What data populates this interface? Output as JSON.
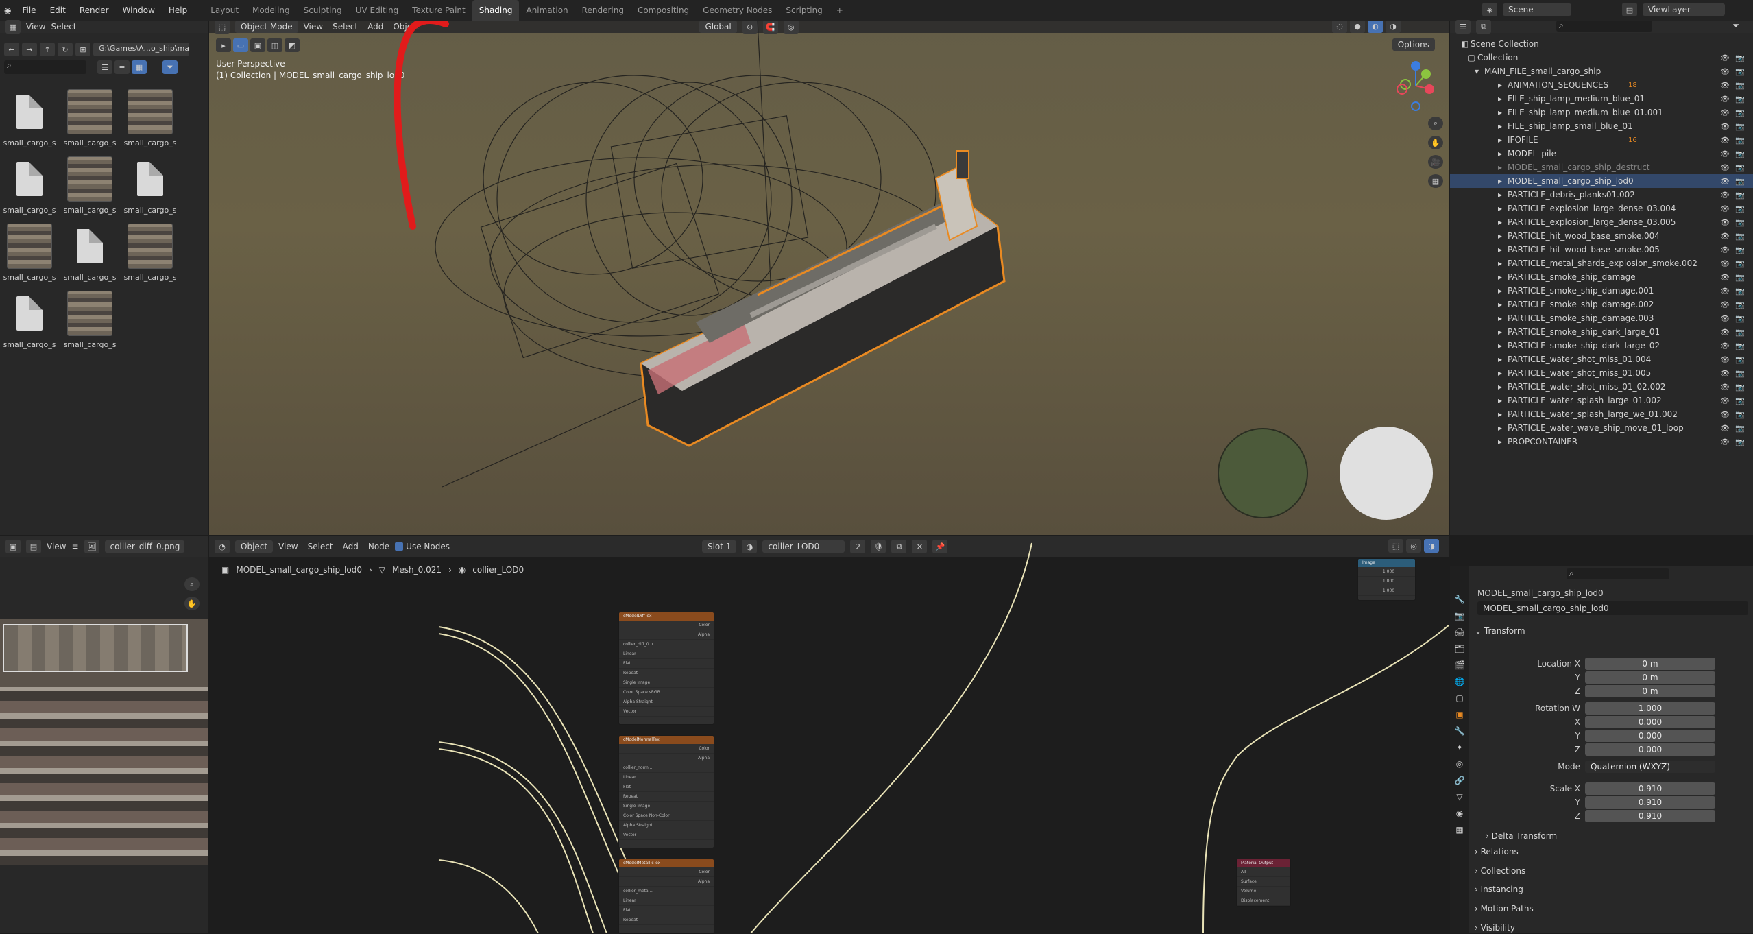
{
  "topbar": {
    "menus": [
      "File",
      "Edit",
      "Render",
      "Window",
      "Help"
    ],
    "workspaces": [
      "Layout",
      "Modeling",
      "Sculpting",
      "UV Editing",
      "Texture Paint",
      "Shading",
      "Animation",
      "Rendering",
      "Compositing",
      "Geometry Nodes",
      "Scripting"
    ],
    "active_workspace": "Shading",
    "add_tab": "+",
    "scene_label": "Scene",
    "viewlayer_label": "ViewLayer"
  },
  "file_browser": {
    "menu_view": "View",
    "menu_select": "Select",
    "path": "G:\\Games\\A...o_ship\\maps\\",
    "files": [
      {
        "name": "small_cargo_s",
        "kind": "doc"
      },
      {
        "name": "small_cargo_s",
        "kind": "tex"
      },
      {
        "name": "small_cargo_s",
        "kind": "tex"
      },
      {
        "name": "small_cargo_s",
        "kind": "doc"
      },
      {
        "name": "small_cargo_s",
        "kind": "tex"
      },
      {
        "name": "small_cargo_s",
        "kind": "doc"
      },
      {
        "name": "small_cargo_s",
        "kind": "tex"
      },
      {
        "name": "small_cargo_s",
        "kind": "doc"
      },
      {
        "name": "small_cargo_s",
        "kind": "tex"
      },
      {
        "name": "small_cargo_s",
        "kind": "doc"
      },
      {
        "name": "small_cargo_s",
        "kind": "tex"
      }
    ]
  },
  "viewport": {
    "mode": "Object Mode",
    "menu": [
      "View",
      "Select",
      "Add",
      "Object"
    ],
    "orientation": "Global",
    "options": "Options",
    "perspective": "User Perspective",
    "context": "(1) Collection | MODEL_small_cargo_ship_lod0",
    "gizmo_axes": [
      "X",
      "Y",
      "Z"
    ]
  },
  "outliner": {
    "root": "Scene Collection",
    "collection": "Collection",
    "main": "MAIN_FILE_small_cargo_ship",
    "items": [
      {
        "name": "ANIMATION_SEQUENCES",
        "badge": "18",
        "state": "normal"
      },
      {
        "name": "FILE_ship_lamp_medium_blue_01",
        "badge": "",
        "state": "normal"
      },
      {
        "name": "FILE_ship_lamp_medium_blue_01.001",
        "badge": "",
        "state": "normal"
      },
      {
        "name": "FILE_ship_lamp_small_blue_01",
        "badge": "",
        "state": "normal"
      },
      {
        "name": "IFOFILE",
        "badge": "16",
        "state": "normal"
      },
      {
        "name": "MODEL_pile",
        "badge": "",
        "state": "normal"
      },
      {
        "name": "MODEL_small_cargo_ship_destruct",
        "badge": "",
        "state": "dim"
      },
      {
        "name": "MODEL_small_cargo_ship_lod0",
        "badge": "",
        "state": "selected"
      },
      {
        "name": "PARTICLE_debris_planks01.002",
        "badge": "",
        "state": "normal"
      },
      {
        "name": "PARTICLE_explosion_large_dense_03.004",
        "badge": "",
        "state": "normal"
      },
      {
        "name": "PARTICLE_explosion_large_dense_03.005",
        "badge": "",
        "state": "normal"
      },
      {
        "name": "PARTICLE_hit_wood_base_smoke.004",
        "badge": "",
        "state": "normal"
      },
      {
        "name": "PARTICLE_hit_wood_base_smoke.005",
        "badge": "",
        "state": "normal"
      },
      {
        "name": "PARTICLE_metal_shards_explosion_smoke.002",
        "badge": "",
        "state": "normal"
      },
      {
        "name": "PARTICLE_smoke_ship_damage",
        "badge": "",
        "state": "normal"
      },
      {
        "name": "PARTICLE_smoke_ship_damage.001",
        "badge": "",
        "state": "normal"
      },
      {
        "name": "PARTICLE_smoke_ship_damage.002",
        "badge": "",
        "state": "normal"
      },
      {
        "name": "PARTICLE_smoke_ship_damage.003",
        "badge": "",
        "state": "normal"
      },
      {
        "name": "PARTICLE_smoke_ship_dark_large_01",
        "badge": "",
        "state": "normal"
      },
      {
        "name": "PARTICLE_smoke_ship_dark_large_02",
        "badge": "",
        "state": "normal"
      },
      {
        "name": "PARTICLE_water_shot_miss_01.004",
        "badge": "",
        "state": "normal"
      },
      {
        "name": "PARTICLE_water_shot_miss_01.005",
        "badge": "",
        "state": "normal"
      },
      {
        "name": "PARTICLE_water_shot_miss_01_02.002",
        "badge": "",
        "state": "normal"
      },
      {
        "name": "PARTICLE_water_splash_large_01.002",
        "badge": "",
        "state": "normal"
      },
      {
        "name": "PARTICLE_water_splash_large_we_01.002",
        "badge": "",
        "state": "normal"
      },
      {
        "name": "PARTICLE_water_wave_ship_move_01_loop",
        "badge": "",
        "state": "normal"
      },
      {
        "name": "PROPCONTAINER",
        "badge": "",
        "state": "normal"
      }
    ]
  },
  "image_editor": {
    "menu_view": "View",
    "image_name": "collier_diff_0.png"
  },
  "node_editor": {
    "object_menu": "Object",
    "menu": [
      "View",
      "Select",
      "Add",
      "Node"
    ],
    "use_nodes": "Use Nodes",
    "slot": "Slot 1",
    "material": "collier_LOD0",
    "users": "2",
    "breadcrumb": [
      "MODEL_small_cargo_ship_lod0",
      "Mesh_0.021",
      "collier_LOD0"
    ],
    "nodes": [
      {
        "title": "cModelDiffTex",
        "rows": [
          "Color",
          "Alpha",
          "collier_diff_0.p...",
          "Linear",
          "Flat",
          "Repeat",
          "Single Image",
          "Color Space   sRGB",
          "Alpha   Straight",
          "Vector"
        ]
      },
      {
        "title": "cModelNormalTex",
        "rows": [
          "Color",
          "Alpha",
          "collier_norm...",
          "Linear",
          "Flat",
          "Repeat",
          "Single Image",
          "Color Space   Non-Color",
          "Alpha   Straight",
          "Vector"
        ]
      },
      {
        "title": "cModelMetallicTex",
        "rows": [
          "Color",
          "Alpha",
          "collier_metal...",
          "Linear",
          "Flat",
          "Repeat"
        ]
      }
    ],
    "output_node": {
      "title": "Material Output",
      "rows": [
        "All",
        "Surface",
        "Volume",
        "Displacement"
      ]
    },
    "image_node": {
      "title": "Image",
      "values": [
        "1.000",
        "1.000",
        "1.000"
      ]
    }
  },
  "properties": {
    "object_name": "MODEL_small_cargo_ship_lod0",
    "object_field": "MODEL_small_cargo_ship_lod0",
    "transform": "Transform",
    "location_label": "Location X",
    "location": [
      "0 m",
      "0 m",
      "0 m"
    ],
    "rotation_label": "Rotation W",
    "rotation": [
      "1.000",
      "0.000",
      "0.000",
      "0.000"
    ],
    "mode_label": "Mode",
    "mode": "Quaternion (WXYZ)",
    "scale_label": "Scale X",
    "scale": [
      "0.910",
      "0.910",
      "0.910"
    ],
    "axis_y": "Y",
    "axis_z": "Z",
    "axis_x": "X",
    "sections": [
      "Delta Transform",
      "Relations",
      "Collections",
      "Instancing",
      "Motion Paths",
      "Visibility"
    ]
  },
  "colors": {
    "accent_orange": "#e98a22",
    "selection_blue": "#33486a",
    "annotation_red": "#e11b1b"
  }
}
